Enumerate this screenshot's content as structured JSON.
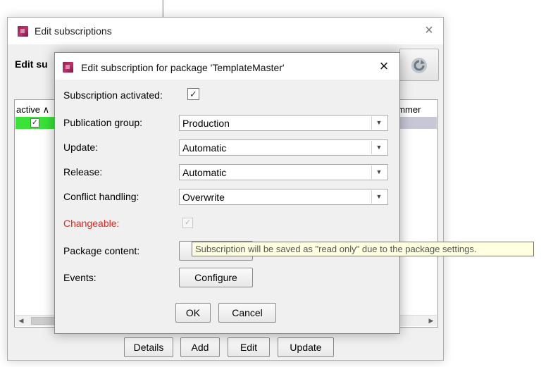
{
  "outer_window": {
    "title": "Edit subscriptions",
    "heading": "Edit su",
    "close_symbol": "×",
    "refresh_icon": "refresh-icon"
  },
  "table": {
    "columns": [
      "active ∧",
      "ommer"
    ],
    "rows": [
      {
        "active": true,
        "active_color": "#3ae23a",
        "checkmark": "✓"
      }
    ],
    "scroll_left": "◀",
    "scroll_right": "▶"
  },
  "outer_buttons": {
    "details": "Details",
    "add": "Add",
    "edit": "Edit",
    "update": "Update"
  },
  "dialog": {
    "title": "Edit subscription for package 'TemplateMaster'",
    "close_symbol": "×",
    "subscription_activated": {
      "label": "Subscription activated:",
      "checked": true,
      "check": "✓"
    },
    "publication_group": {
      "label": "Publication group:",
      "value": "Production"
    },
    "update": {
      "label": "Update:",
      "value": "Automatic"
    },
    "release": {
      "label": "Release:",
      "value": "Automatic"
    },
    "conflict_handling": {
      "label": "Conflict handling:",
      "value": "Overwrite"
    },
    "changeable": {
      "label": "Changeable:",
      "checked": true,
      "disabled": true,
      "check": "✓",
      "label_color": "#e8231c"
    },
    "package_content": {
      "label": "Package content:"
    },
    "events": {
      "label": "Events:",
      "button": "Configure"
    },
    "ok": "OK",
    "cancel": "Cancel",
    "dropdown_arrow": "▼"
  },
  "tooltip": {
    "text": "Subscription will be saved as \"read only\" due to the package settings."
  },
  "colors": {
    "brand": "#9c1c55",
    "warning_label": "#e8231c",
    "tooltip_bg": "#ffffe1",
    "selected_row": "#c6c8d6"
  }
}
